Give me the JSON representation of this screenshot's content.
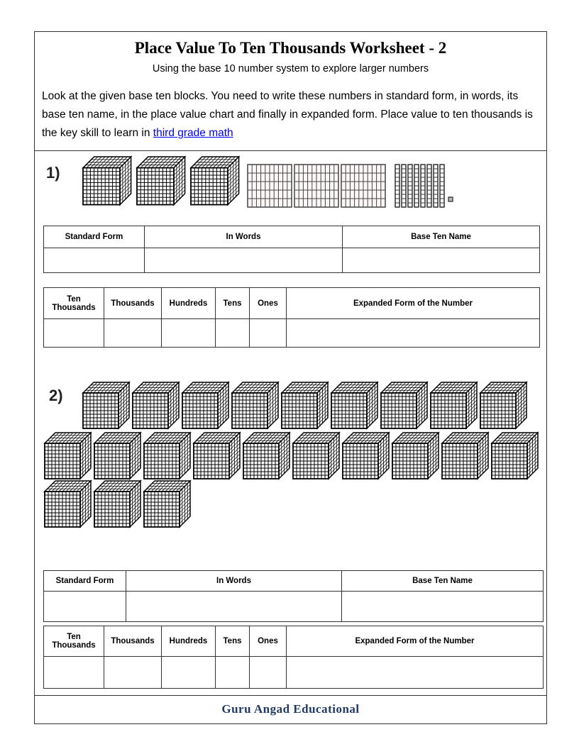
{
  "header": {
    "title": "Place Value To Ten Thousands Worksheet - 2",
    "subtitle": "Using the base 10 number system to explore larger numbers",
    "instructions_text": "Look at the given base ten blocks. You need to write these numbers in standard form, in words, its base ten name, in the place value chart and finally in expanded form. Place value to ten thousands is the key skill to learn in ",
    "link_text": "third grade math"
  },
  "problems": [
    {
      "label": "1)",
      "blocks": {
        "thousands_cubes": 3,
        "hundreds_flats": 3,
        "tens_rods": 8,
        "ones_units": 1
      },
      "table1_headers": [
        "Standard Form",
        "In Words",
        "Base Ten Name"
      ],
      "table2_headers": [
        "Ten Thousands",
        "Thousands",
        "Hundreds",
        "Tens",
        "Ones",
        "Expanded Form of the Number"
      ]
    },
    {
      "label": "2)",
      "blocks": {
        "thousands_cubes": 22,
        "hundreds_flats": 0,
        "tens_rods": 0,
        "ones_units": 0
      },
      "table1_headers": [
        "Standard Form",
        "In Words",
        "Base Ten Name"
      ],
      "table2_headers": [
        "Ten Thousands",
        "Thousands",
        "Hundreds",
        "Tens",
        "Ones",
        "Expanded Form of the Number"
      ]
    }
  ],
  "footer": {
    "brand": "Guru Angad Educational"
  },
  "colors": {
    "link": "#0000ee",
    "footer_brand": "#1f3a66",
    "border": "#333333"
  }
}
